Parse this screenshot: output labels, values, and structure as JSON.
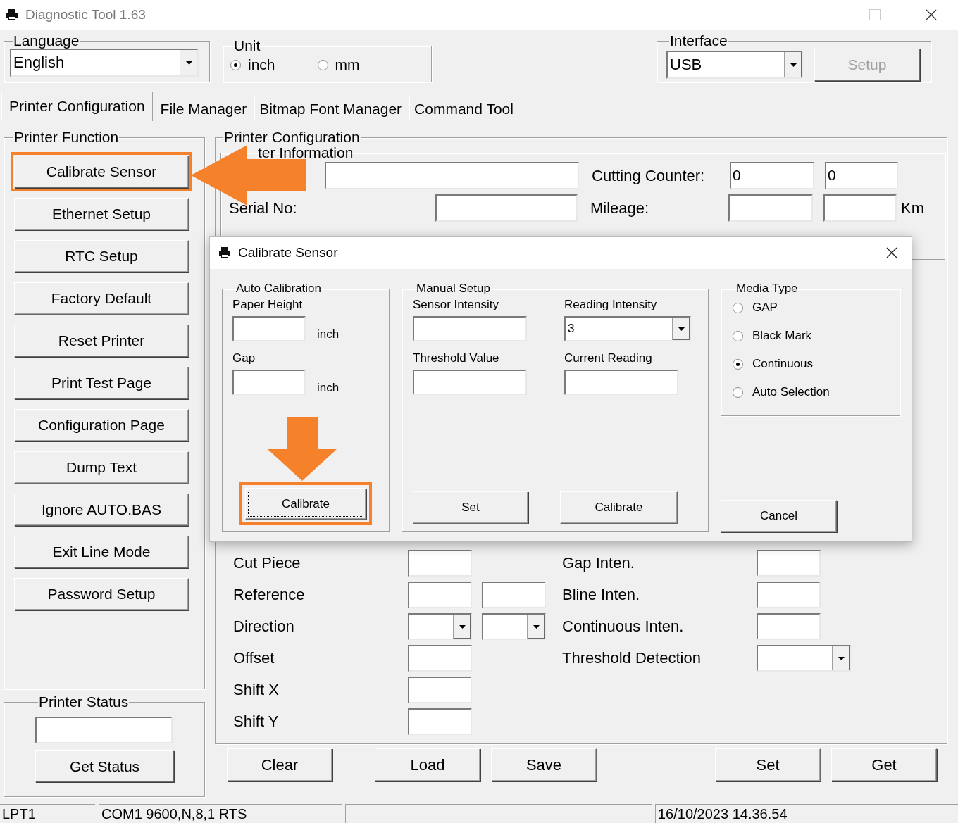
{
  "window": {
    "title": "Diagnostic Tool 1.63"
  },
  "language": {
    "label": "Language",
    "value": "English"
  },
  "unit": {
    "label": "Unit",
    "options": [
      {
        "label": "inch",
        "selected": true
      },
      {
        "label": "mm",
        "selected": false
      }
    ]
  },
  "interface": {
    "label": "Interface",
    "value": "USB",
    "button": {
      "label": "Setup",
      "disabled": true
    }
  },
  "tabs": [
    {
      "label": "Printer Configuration",
      "selected": true
    },
    {
      "label": "File Manager",
      "selected": false
    },
    {
      "label": "Bitmap Font Manager",
      "selected": false
    },
    {
      "label": "Command Tool",
      "selected": false
    }
  ],
  "printer_function": {
    "title": "Printer Function",
    "buttons": [
      {
        "label": "Calibrate Sensor",
        "highlighted": true
      },
      {
        "label": "Ethernet Setup",
        "highlighted": false
      },
      {
        "label": "RTC Setup",
        "highlighted": false
      },
      {
        "label": "Factory Default",
        "highlighted": false
      },
      {
        "label": "Reset Printer",
        "highlighted": false
      },
      {
        "label": "Print Test Page",
        "highlighted": false
      },
      {
        "label": "Configuration Page",
        "highlighted": false
      },
      {
        "label": "Dump Text",
        "highlighted": false
      },
      {
        "label": "Ignore AUTO.BAS",
        "highlighted": false
      },
      {
        "label": "Exit Line Mode",
        "highlighted": false
      },
      {
        "label": "Password Setup",
        "highlighted": false
      }
    ]
  },
  "printer_status": {
    "title": "Printer Status",
    "button": "Get Status"
  },
  "printer_configuration": {
    "title": "Printer Configuration",
    "info": {
      "title": "ter Information",
      "cutting_counter": {
        "label": "Cutting Counter:",
        "values": [
          "0",
          "0"
        ]
      },
      "serial_no": {
        "label": "Serial No:"
      },
      "mileage": {
        "label": "Mileage:",
        "unit": "Km"
      }
    },
    "settings": [
      {
        "label": "Cut Piece",
        "fields": [
          {
            "kind": "text"
          }
        ],
        "right": {
          "label": "Gap Inten.",
          "kind": "text"
        }
      },
      {
        "label": "Reference",
        "fields": [
          {
            "kind": "text"
          },
          {
            "kind": "text"
          }
        ],
        "right": {
          "label": "Bline Inten.",
          "kind": "text"
        }
      },
      {
        "label": "Direction",
        "fields": [
          {
            "kind": "dropdown"
          },
          {
            "kind": "dropdown"
          }
        ],
        "right": {
          "label": "Continuous Inten.",
          "kind": "text"
        }
      },
      {
        "label": "Offset",
        "fields": [
          {
            "kind": "text"
          }
        ],
        "right": {
          "label": "Threshold Detection",
          "kind": "dropdown"
        }
      },
      {
        "label": "Shift X",
        "fields": [
          {
            "kind": "text"
          }
        ]
      },
      {
        "label": "Shift Y",
        "fields": [
          {
            "kind": "text"
          }
        ]
      }
    ],
    "left_buttons": [
      "Clear",
      "Load",
      "Save"
    ],
    "right_buttons": [
      "Set",
      "Get"
    ]
  },
  "status_bar": {
    "port": "LPT1",
    "serial": "COM1 9600,N,8,1 RTS",
    "time": "16/10/2023 14.36.54"
  },
  "dialog": {
    "title": "Calibrate Sensor",
    "auto_calibration": {
      "title": "Auto Calibration",
      "fields": [
        {
          "label": "Paper Height",
          "unit": "inch"
        },
        {
          "label": "Gap",
          "unit": "inch"
        }
      ],
      "button": {
        "label": "Calibrate",
        "highlighted": true
      }
    },
    "manual_setup": {
      "title": "Manual Setup",
      "fields": [
        {
          "label": "Sensor Intensity",
          "kind": "text"
        },
        {
          "label": "Reading Intensity",
          "kind": "dropdown",
          "value": "3"
        },
        {
          "label": "Threshold Value",
          "kind": "text"
        },
        {
          "label": "Current Reading",
          "kind": "text"
        }
      ],
      "buttons": [
        "Set",
        "Calibrate"
      ]
    },
    "media_type": {
      "title": "Media Type",
      "options": [
        {
          "label": "GAP",
          "selected": false
        },
        {
          "label": "Black Mark",
          "selected": false
        },
        {
          "label": "Continuous",
          "selected": true
        },
        {
          "label": "Auto Selection",
          "selected": false
        }
      ]
    },
    "cancel": "Cancel"
  }
}
